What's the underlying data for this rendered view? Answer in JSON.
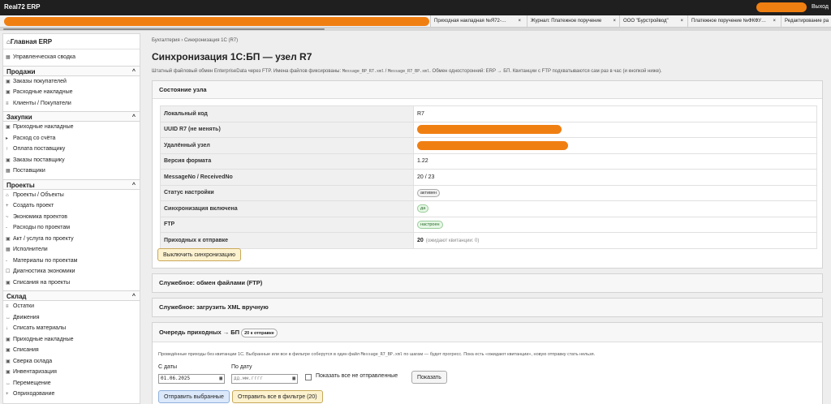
{
  "app": {
    "title": "Real72 ERP",
    "logout": "Выход"
  },
  "tabs": [
    {
      "label": "Приходная накладная №Я72-…",
      "close": "×"
    },
    {
      "label": "Журнал: Платежное поручение",
      "close": "×"
    },
    {
      "label": "ООО \"Бурстройвод\"",
      "close": "×"
    },
    {
      "label": "Платежное поручение №ФКФУ…",
      "close": "×"
    },
    {
      "label": "Редактирование ра",
      "close": ""
    }
  ],
  "sidebar": {
    "home": "Главная ERP",
    "summary": "Управленческая сводка",
    "sections": [
      {
        "title": "Продажи",
        "chevron": "^",
        "items": [
          {
            "label": "Заказы покупателей",
            "icon": "▣"
          },
          {
            "label": "Расходные накладные",
            "icon": "▣"
          },
          {
            "label": "Клиенты / Покупатели",
            "icon": "≡"
          }
        ]
      },
      {
        "title": "Закупки",
        "chevron": "^",
        "items": [
          {
            "label": "Приходные накладные",
            "icon": "▣"
          },
          {
            "label": "Расход со счёта",
            "icon": "▸"
          },
          {
            "label": "Оплата поставщику",
            "icon": "↑"
          },
          {
            "label": "Заказы поставщику",
            "icon": "▣"
          },
          {
            "label": "Поставщики",
            "icon": "▦"
          }
        ]
      },
      {
        "title": "Проекты",
        "chevron": "^",
        "items": [
          {
            "label": "Проекты / Объекты",
            "icon": "⌂"
          },
          {
            "label": "Создать проект",
            "icon": "+"
          },
          {
            "label": "Экономика проектов",
            "icon": "~"
          },
          {
            "label": "Расходы по проектам",
            "icon": "-"
          },
          {
            "label": "Акт / услуга по проекту",
            "icon": "▣"
          },
          {
            "label": "Исполнители",
            "icon": "▦"
          },
          {
            "label": "Материалы по проектам",
            "icon": "-"
          },
          {
            "label": "Диагностика экономики",
            "icon": "☐"
          },
          {
            "label": "Списания на проекты",
            "icon": "▣"
          }
        ]
      },
      {
        "title": "Склад",
        "chevron": "^",
        "items": [
          {
            "label": "Остатки",
            "icon": "≡"
          },
          {
            "label": "Движения",
            "icon": "↔"
          },
          {
            "label": "Списать материалы",
            "icon": "↓"
          },
          {
            "label": "Приходные накладные",
            "icon": "▣"
          },
          {
            "label": "Списания",
            "icon": "▣"
          },
          {
            "label": "Сверка склада",
            "icon": "▣"
          },
          {
            "label": "Инвентаризация",
            "icon": "▣"
          },
          {
            "label": "Перемещение",
            "icon": "↔"
          },
          {
            "label": "Оприходование",
            "icon": "+"
          }
        ]
      }
    ]
  },
  "main": {
    "breadcrumb": "Бухгалтерия › Синхронизация 1С (R7)",
    "title": "Синхронизация 1С:БП — узел R7",
    "description_pre": "Штатный файловый обмен EnterpriseData через FTP. Имена файлов фиксированы: ",
    "file_a": "Message_BP_R7.xml",
    "description_mid": " / ",
    "file_b": "Message_R7_BP.xml",
    "description_post": ". Обмен односторонний: ERP → БП. Квитанции с FTP подхватываются сам раз в час (и кнопкой ниже).",
    "status_panel": {
      "title": "Состояние узла",
      "rows": [
        {
          "key": "Локальный код",
          "value": "R7"
        },
        {
          "key": "UUID R7 (не менять)",
          "value": ""
        },
        {
          "key": "Удалённый узел",
          "value": ""
        },
        {
          "key": "Версия формата",
          "value": "1.22"
        },
        {
          "key": "MessageNo / ReceivedNo",
          "value": "20 / 23"
        },
        {
          "key": "Статус настройки",
          "value": "активен"
        },
        {
          "key": "Синхронизация включена",
          "value": "да"
        },
        {
          "key": "FTP",
          "value": "настроен"
        },
        {
          "key": "Приходных к отправке",
          "value": "20",
          "note": "(ожидают квитанции: 0)"
        }
      ],
      "disable_button": "Выключить синхронизацию"
    },
    "ftp_panel_title": "Служебное: обмен файлами (FTP)",
    "xml_panel_title": "Служебное: загрузить XML вручную",
    "queue": {
      "title": "Очередь приходных → БП",
      "badge": "20 к отправке",
      "hint_pre": "Проведённые приходы без квитанции 1С. Выбранные или все в фильтре соберутся в один файл ",
      "hint_file": "Message_R7_BP.xml",
      "hint_post": " по шагам — будет прогресс. Пока есть «ожидают квитанции», новую отправку стать нельзя.",
      "date_from_label": "С даты",
      "date_from_value": "01.06.2025",
      "date_to_label": "По дату",
      "date_to_placeholder": "дд.мм.гггг",
      "show_all_label": "Показать все не отправленные",
      "show_button": "Показать",
      "send_selected": "Отправить выбранные",
      "send_all": "Отправить все в фильтре (20)"
    }
  },
  "colors": {
    "accent": "#f07f12",
    "topbar": "#1f1f1f",
    "row_key_bg": "#f0f0f0",
    "button_bg": "#fdf2cf"
  }
}
